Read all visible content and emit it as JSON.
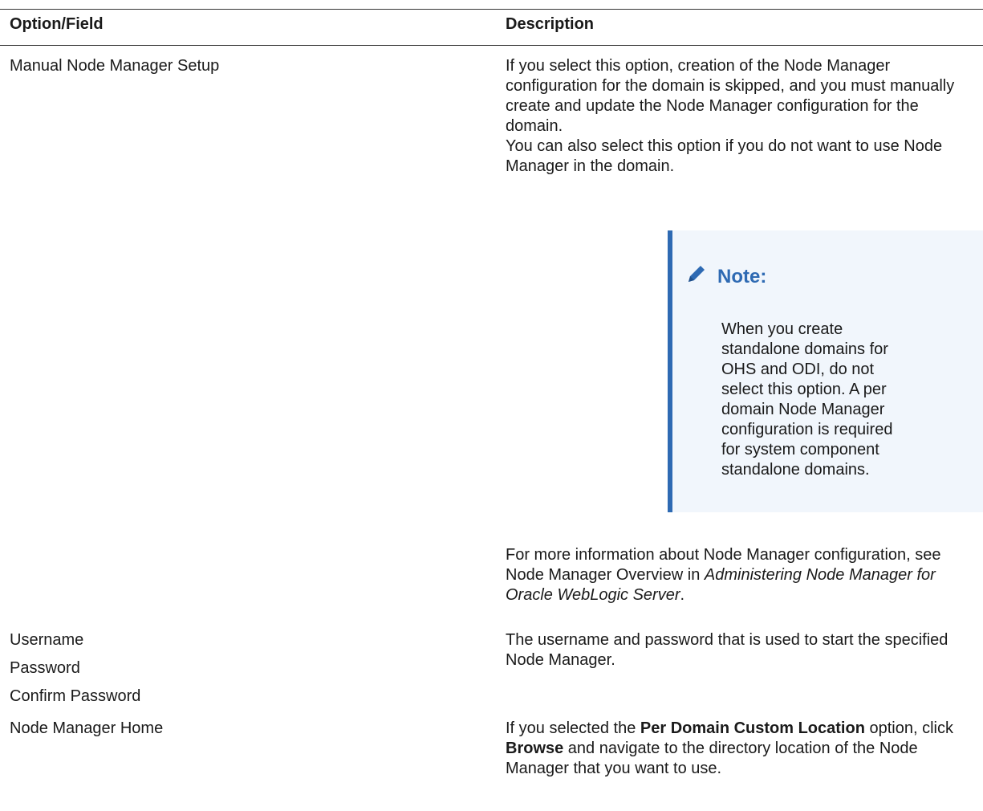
{
  "table": {
    "header": {
      "col1": "Option/Field",
      "col2": "Description"
    },
    "rows": [
      {
        "option": "Manual Node Manager Setup",
        "desc_p1": "If you select this option, creation of the Node Manager configuration for the domain is skipped, and you must manually create and update the Node Manager configuration for the domain.",
        "desc_p2": "You can also select this option if you do not want to use Node Manager in the domain.",
        "note": {
          "icon": "pencil-icon",
          "title": "Note:",
          "body": "When you create standalone domains for OHS and ODI, do not select this option. A per domain Node Manager configuration is required for system component standalone domains."
        },
        "desc_p3_prefix": "For more information about Node Manager configuration, see Node Manager Overview in ",
        "desc_p3_italic": "Administering Node Manager for Oracle WebLogic Server",
        "desc_p3_suffix": "."
      },
      {
        "options": [
          "Username",
          "Password",
          "Confirm Password"
        ],
        "desc": "The username and password that is used to start the specified Node Manager."
      },
      {
        "option": "Node Manager Home",
        "desc_prefix": "If you selected the ",
        "desc_bold1": "Per Domain Custom Location",
        "desc_mid": " option, click ",
        "desc_bold2": "Browse",
        "desc_suffix": " and navigate to the directory location of the Node Manager that you want to use."
      }
    ]
  },
  "colors": {
    "accent": "#2e6ab3",
    "note_bg": "#f1f6fc"
  }
}
